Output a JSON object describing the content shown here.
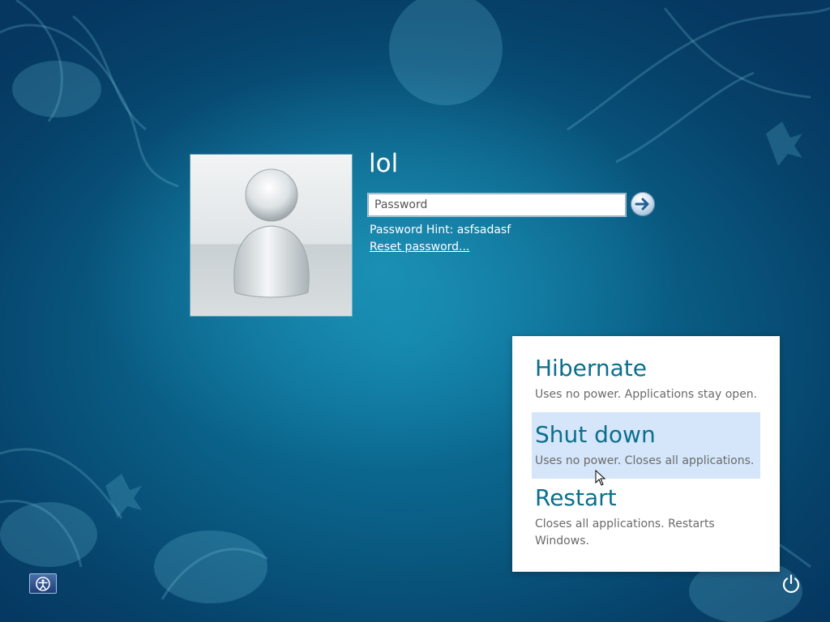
{
  "user": {
    "name": "lol",
    "avatar_icon": "default-user-silhouette-icon"
  },
  "login": {
    "password_placeholder": "Password",
    "password_value": "",
    "submit_icon": "arrow-right-icon",
    "hint": "Password Hint: asfsadasf",
    "reset_link": "Reset password..."
  },
  "power_menu": {
    "items": [
      {
        "label": "Hibernate",
        "description": "Uses no power. Applications stay open."
      },
      {
        "label": "Shut down",
        "description": "Uses no power. Closes all applications."
      },
      {
        "label": "Restart",
        "description": "Closes all applications. Restarts Windows."
      }
    ],
    "highlighted_item": "Shut down"
  },
  "footer": {
    "ease_of_access_icon": "ease-of-access-icon",
    "power_icon": "power-icon"
  },
  "colors": {
    "accent_text": "#0b6f8c",
    "highlight": "#d5e6fa",
    "background": "#0a5f86"
  }
}
